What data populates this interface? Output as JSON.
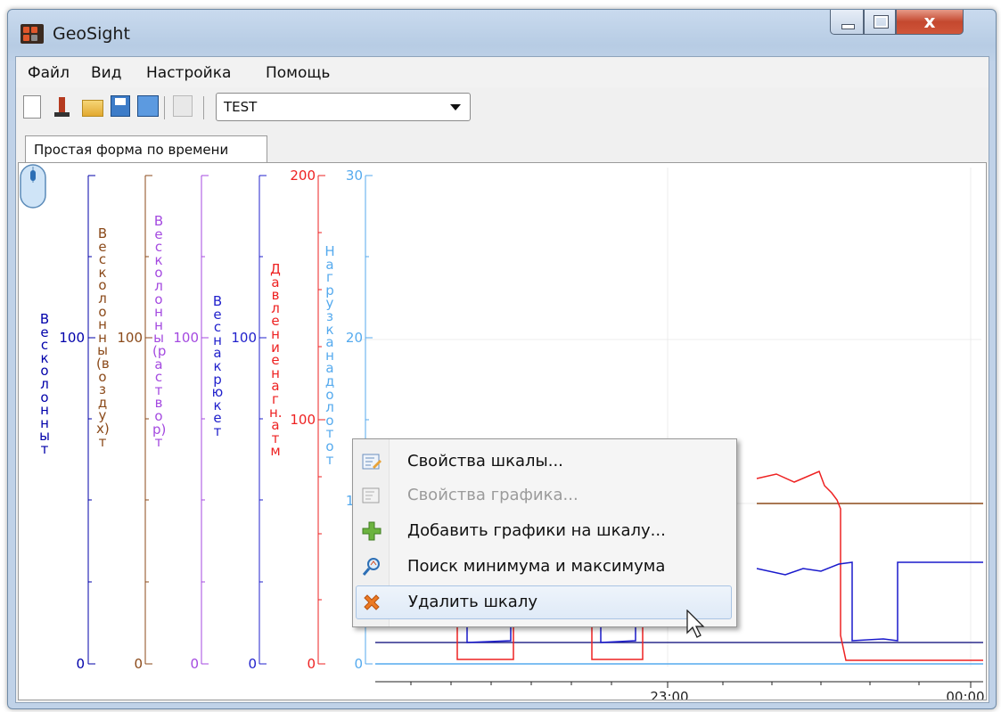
{
  "window": {
    "title": "GeoSight"
  },
  "menu": [
    "Файл",
    "Вид",
    "Настройка",
    "Помощь"
  ],
  "toolbar": {
    "project_value": "TEST"
  },
  "tabs": [
    {
      "label": "Простая форма по времени"
    }
  ],
  "axes": [
    {
      "label": "Вес колонны т",
      "color": "#0000aa",
      "ticks": [
        "100",
        "0"
      ]
    },
    {
      "label": "Вес колонны (воздух) т",
      "color": "#8b4a1a",
      "ticks": [
        "100",
        "0"
      ]
    },
    {
      "label": "Вес колонны (раствор) т",
      "color": "#a44ae0",
      "ticks": [
        "100",
        "0"
      ]
    },
    {
      "label": "Вес на крюке т",
      "color": "#2222cc",
      "ticks": [
        "100",
        "0"
      ]
    },
    {
      "label": "Давление нагн. атм",
      "color": "#ee2222",
      "ticks": [
        "200",
        "100",
        "0"
      ]
    },
    {
      "label": "Нагрузка на долото т",
      "color": "#55aaee",
      "ticks": [
        "30",
        "20",
        "10",
        "0"
      ]
    }
  ],
  "time_axis": {
    "ticks": [
      "23:00",
      "00:00"
    ]
  },
  "context_menu": {
    "items": [
      {
        "label": "Свойства шкалы...",
        "icon": "scale-properties-icon",
        "enabled": true
      },
      {
        "label": "Свойства графика...",
        "icon": "chart-properties-icon",
        "enabled": false
      },
      {
        "label": "Добавить графики на шкалу...",
        "icon": "add-icon",
        "enabled": true
      },
      {
        "label": "Поиск минимума и максимума",
        "icon": "search-minmax-icon",
        "enabled": true
      },
      {
        "label": "Удалить шкалу",
        "icon": "delete-icon",
        "enabled": true,
        "highlighted": true
      }
    ]
  }
}
